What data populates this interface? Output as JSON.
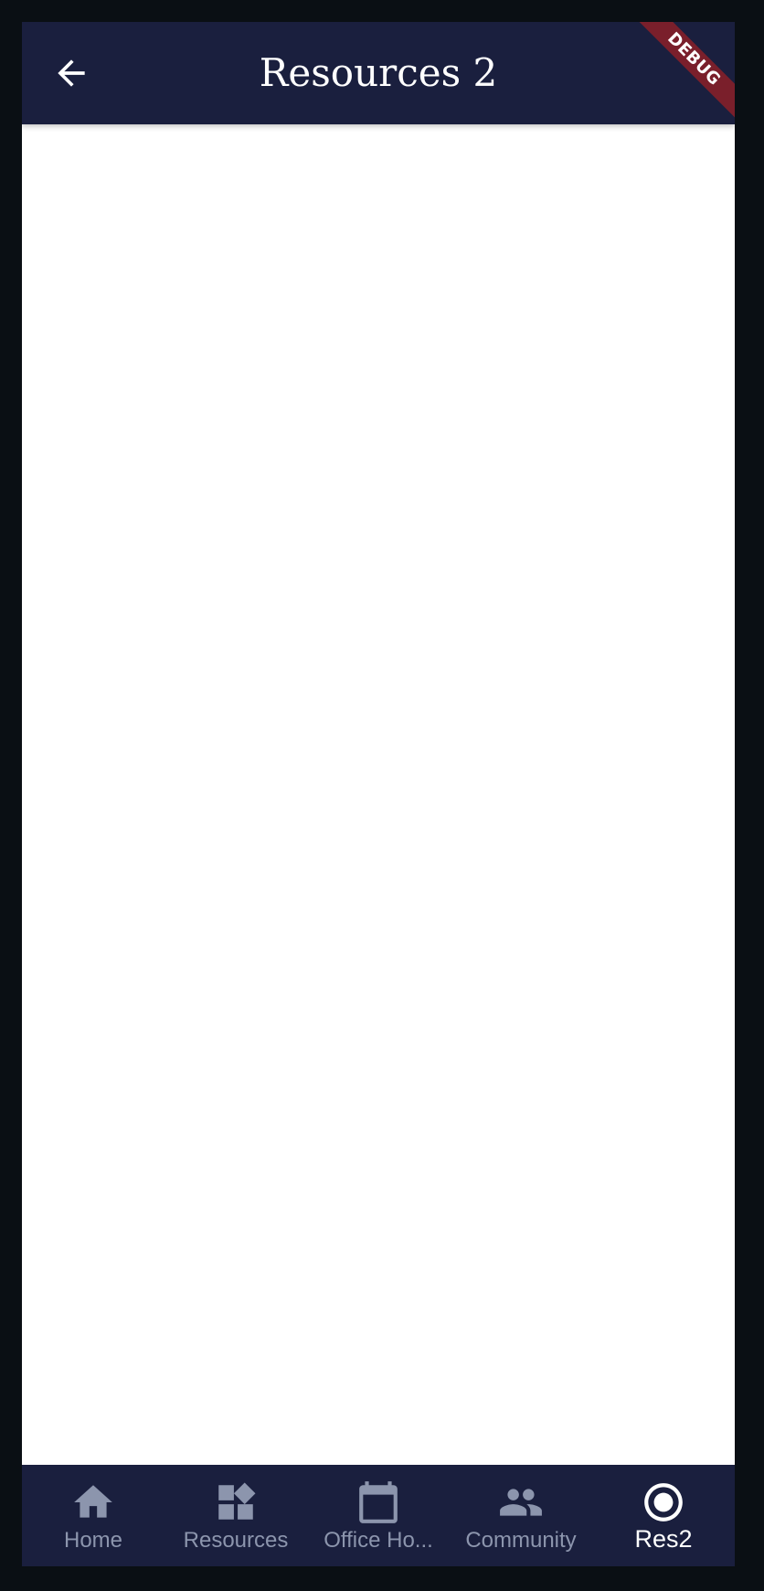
{
  "appbar": {
    "title": "Resources 2",
    "debug_label": "DEBUG"
  },
  "colors": {
    "appbar_bg": "#1a1f3e",
    "nav_inactive": "#8c95ad",
    "nav_active": "#ffffff",
    "debug_ribbon": "#7a1f2b"
  },
  "bottom_nav": {
    "items": [
      {
        "label": "Home",
        "icon": "home-icon",
        "active": false
      },
      {
        "label": "Resources",
        "icon": "widgets-icon",
        "active": false
      },
      {
        "label": "Office Ho...",
        "icon": "calendar-icon",
        "active": false
      },
      {
        "label": "Community",
        "icon": "people-icon",
        "active": false
      },
      {
        "label": "Res2",
        "icon": "radio-button-icon",
        "active": true
      }
    ]
  }
}
